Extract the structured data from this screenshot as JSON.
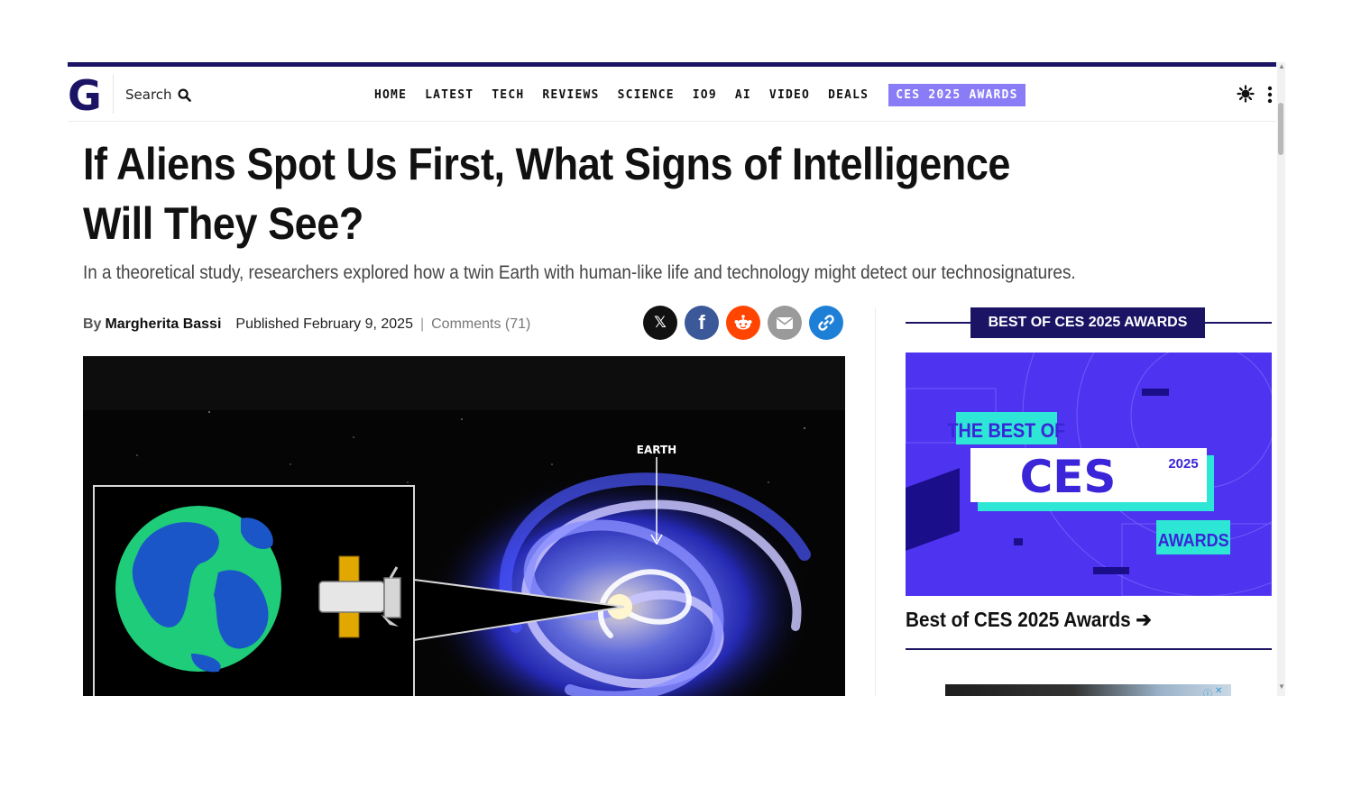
{
  "header": {
    "logo_letter": "G",
    "search_label": "Search",
    "nav": [
      "HOME",
      "LATEST",
      "TECH",
      "REVIEWS",
      "SCIENCE",
      "IO9",
      "AI",
      "VIDEO",
      "DEALS"
    ],
    "nav_highlight": "CES 2025 AWARDS"
  },
  "article": {
    "title": "If Aliens Spot Us First, What Signs of Intelligence Will They See?",
    "dek": "In a theoretical study, researchers explored how a twin Earth with human-like life and technology might detect our technosignatures.",
    "by": "By",
    "author": "Margherita Bassi",
    "published": "Published February 9, 2025",
    "separator": "|",
    "comments": "Comments (71)",
    "hero_label": "EARTH"
  },
  "share": {
    "x": "𝕏",
    "facebook": "f"
  },
  "sidebar": {
    "badge": "BEST OF CES 2025 AWARDS",
    "promo_line1": "THE BEST OF",
    "promo_brand": "CES",
    "promo_year": "2025",
    "promo_awards": "AWARDS",
    "promo_link": "Best of CES 2025 Awards ➔"
  },
  "colors": {
    "brand": "#1b1464",
    "accent": "#8a7cf6",
    "promo_bg": "#4e33f0",
    "promo_teal": "#2ee6d6"
  }
}
